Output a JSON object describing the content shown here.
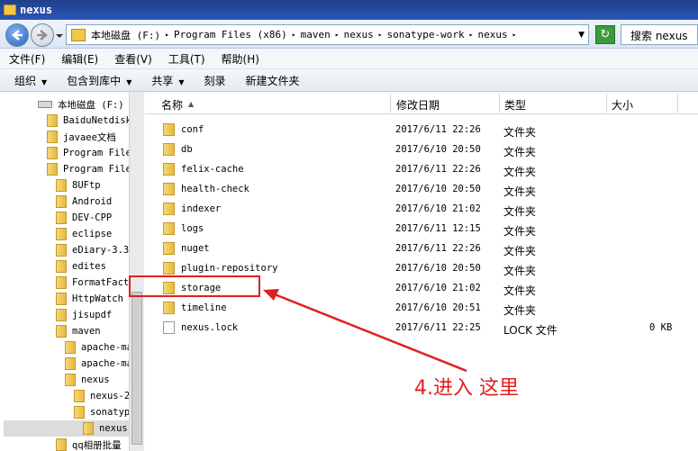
{
  "window": {
    "title": "nexus"
  },
  "nav": {
    "breadcrumbs": [
      "本地磁盘 (F:)",
      "Program Files (x86)",
      "maven",
      "nexus",
      "sonatype-work",
      "nexus"
    ],
    "search_placeholder": "搜索 nexus"
  },
  "menu": {
    "items": [
      "文件(F)",
      "编辑(E)",
      "查看(V)",
      "工具(T)",
      "帮助(H)"
    ]
  },
  "toolbar": {
    "organize": "组织",
    "include_library": "包含到库中",
    "share": "共享",
    "burn": "刻录",
    "new_folder": "新建文件夹"
  },
  "sidebar": {
    "items": [
      {
        "label": "本地磁盘 (F:)",
        "type": "drive"
      },
      {
        "label": "BaiduNetdisk"
      },
      {
        "label": "javaee文档"
      },
      {
        "label": "Program File"
      },
      {
        "label": "Program File"
      },
      {
        "label": "8UFtp"
      },
      {
        "label": "Android"
      },
      {
        "label": "DEV-CPP"
      },
      {
        "label": "eclipse"
      },
      {
        "label": "eDiary-3.3"
      },
      {
        "label": "edites"
      },
      {
        "label": "FormatFact"
      },
      {
        "label": "HttpWatch"
      },
      {
        "label": "jisupdf"
      },
      {
        "label": "maven"
      },
      {
        "label": "apache-ma"
      },
      {
        "label": "apache-ma"
      },
      {
        "label": "nexus"
      },
      {
        "label": "nexus-2"
      },
      {
        "label": "sonatyp"
      },
      {
        "label": "nexus",
        "selected": true
      },
      {
        "label": "qq相册批量"
      }
    ]
  },
  "columns": {
    "name": "名称",
    "date": "修改日期",
    "type": "类型",
    "size": "大小"
  },
  "files": [
    {
      "name": "conf",
      "date": "2017/6/11 22:26",
      "type": "文件夹",
      "size": "",
      "kind": "folder"
    },
    {
      "name": "db",
      "date": "2017/6/10 20:50",
      "type": "文件夹",
      "size": "",
      "kind": "folder"
    },
    {
      "name": "felix-cache",
      "date": "2017/6/11 22:26",
      "type": "文件夹",
      "size": "",
      "kind": "folder"
    },
    {
      "name": "health-check",
      "date": "2017/6/10 20:50",
      "type": "文件夹",
      "size": "",
      "kind": "folder"
    },
    {
      "name": "indexer",
      "date": "2017/6/10 21:02",
      "type": "文件夹",
      "size": "",
      "kind": "folder"
    },
    {
      "name": "logs",
      "date": "2017/6/11 12:15",
      "type": "文件夹",
      "size": "",
      "kind": "folder"
    },
    {
      "name": "nuget",
      "date": "2017/6/11 22:26",
      "type": "文件夹",
      "size": "",
      "kind": "folder"
    },
    {
      "name": "plugin-repository",
      "date": "2017/6/10 20:50",
      "type": "文件夹",
      "size": "",
      "kind": "folder"
    },
    {
      "name": "storage",
      "date": "2017/6/10 21:02",
      "type": "文件夹",
      "size": "",
      "kind": "folder"
    },
    {
      "name": "timeline",
      "date": "2017/6/10 20:51",
      "type": "文件夹",
      "size": "",
      "kind": "folder"
    },
    {
      "name": "nexus.lock",
      "date": "2017/6/11 22:25",
      "type": "LOCK 文件",
      "size": "0 KB",
      "kind": "file"
    }
  ],
  "annotation": {
    "text": "4.进入 这里",
    "color": "#e02020"
  }
}
